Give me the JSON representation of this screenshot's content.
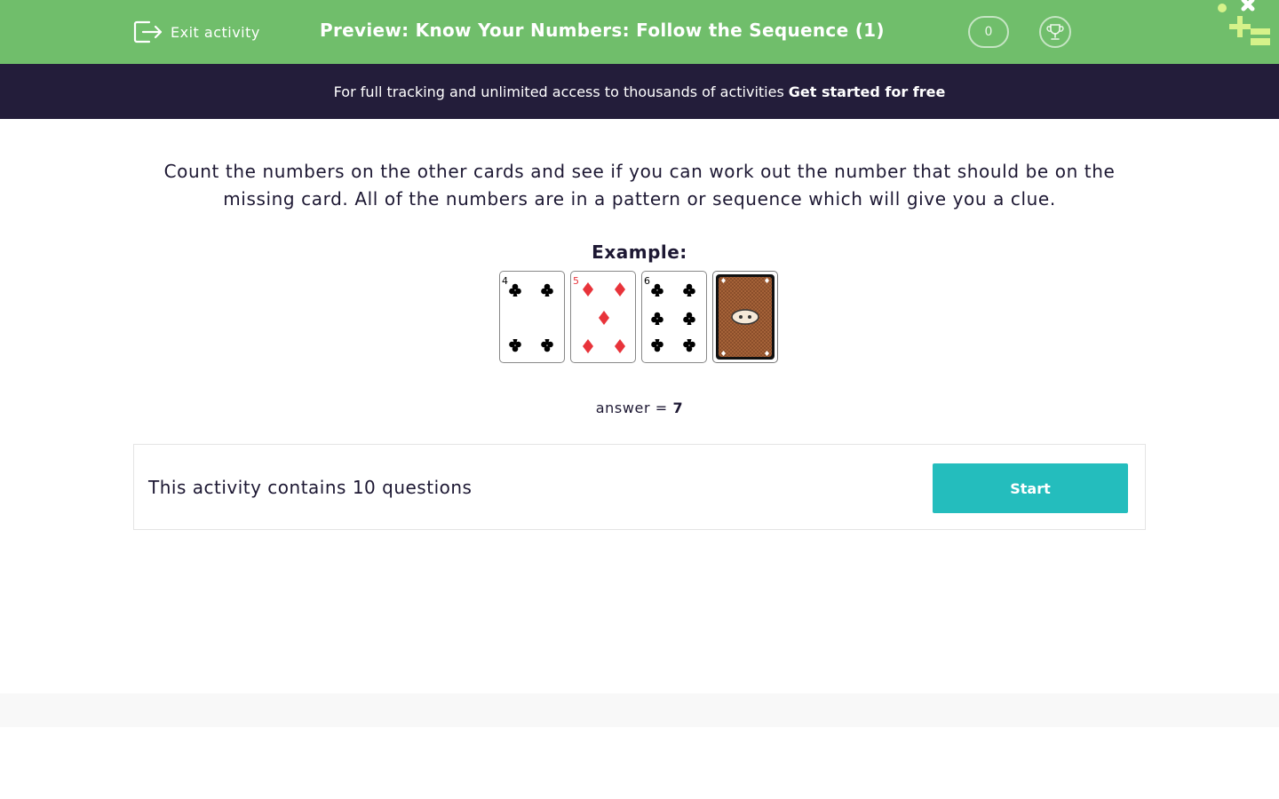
{
  "header": {
    "exit_label": "Exit activity",
    "title": "Preview: Know Your Numbers: Follow the Sequence (1)",
    "score": "0"
  },
  "promo": {
    "text": "For full tracking and unlimited access to thousands of activities",
    "link": "Get started for free"
  },
  "question": {
    "instructions": "Count the numbers on the other cards and see if you can work out the number that should be on the missing card. All of the numbers are in a pattern or sequence which will give you a clue.",
    "example_label": "Example:",
    "cards": [
      {
        "rank": "4",
        "suit": "clubs"
      },
      {
        "rank": "5",
        "suit": "diamonds"
      },
      {
        "rank": "6",
        "suit": "clubs"
      },
      {
        "rank": "",
        "suit": "face-down"
      }
    ],
    "answer_prefix": "answer =",
    "answer_value": "7"
  },
  "activity": {
    "count_text": "This activity contains 10 questions",
    "start_label": "Start"
  },
  "colors": {
    "header_green": "#70be6b",
    "promo_bg": "#231d3a",
    "start_teal": "#24bdbd",
    "text_dark": "#1d1833",
    "diamond_red": "#e8333a",
    "card_back": "#a8653a"
  }
}
